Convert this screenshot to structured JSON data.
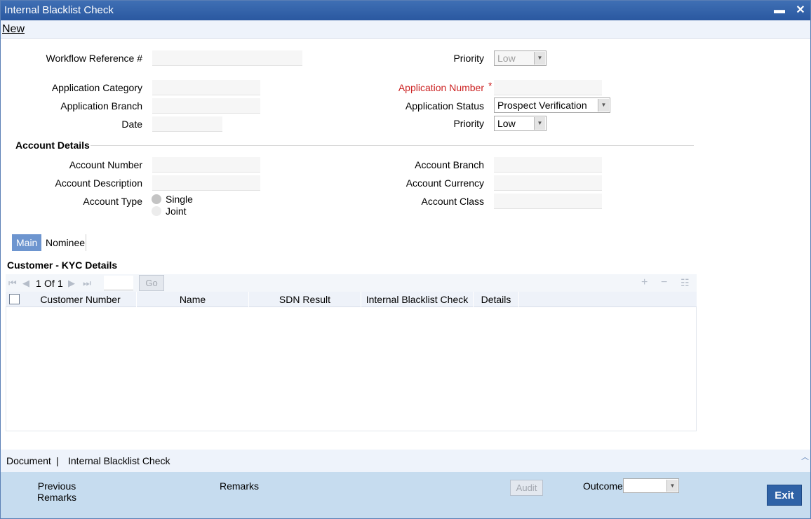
{
  "window": {
    "title": "Internal Blacklist Check",
    "minimize_glyph": "▬",
    "close_glyph": "✕"
  },
  "menu": {
    "new": "New"
  },
  "form": {
    "workflow_reference_label": "Workflow Reference #",
    "priority_top_label": "Priority",
    "priority_top_value": "Low",
    "application_category_label": "Application Category",
    "application_number_label": "Application Number",
    "required_marker": "*",
    "application_branch_label": "Application Branch",
    "application_status_label": "Application Status",
    "application_status_value": "Prospect Verification",
    "date_label": "Date",
    "priority_label": "Priority",
    "priority_value": "Low"
  },
  "account_details": {
    "title": "Account Details",
    "account_number_label": "Account Number",
    "account_branch_label": "Account Branch",
    "account_description_label": "Account Description",
    "account_currency_label": "Account Currency",
    "account_type_label": "Account Type",
    "account_class_label": "Account Class",
    "type_options": [
      "Single",
      "Joint"
    ]
  },
  "tabs": [
    {
      "label": "Main",
      "active": true
    },
    {
      "label": "Nominee",
      "active": false
    }
  ],
  "kyc": {
    "title": "Customer - KYC Details",
    "pager": {
      "current": "1",
      "of_label": "Of",
      "total": "1",
      "go_label": "Go"
    },
    "columns": [
      "Customer Number",
      "Name",
      "SDN Result",
      "Internal Blacklist Check",
      "Details"
    ]
  },
  "footer_links": {
    "document": "Document",
    "separator": "|",
    "internal_blacklist_check": "Internal Blacklist Check"
  },
  "footer": {
    "previous_remarks_line1": "Previous",
    "previous_remarks_line2": "Remarks",
    "remarks": "Remarks",
    "audit": "Audit",
    "outcome_label": "Outcome",
    "exit": "Exit"
  },
  "colors": {
    "titlebar": "#3f6fb4",
    "required_label": "#cc2222",
    "active_tab": "#6d95cf",
    "footer": "#c6dcef",
    "exit_button": "#2f62a6"
  }
}
